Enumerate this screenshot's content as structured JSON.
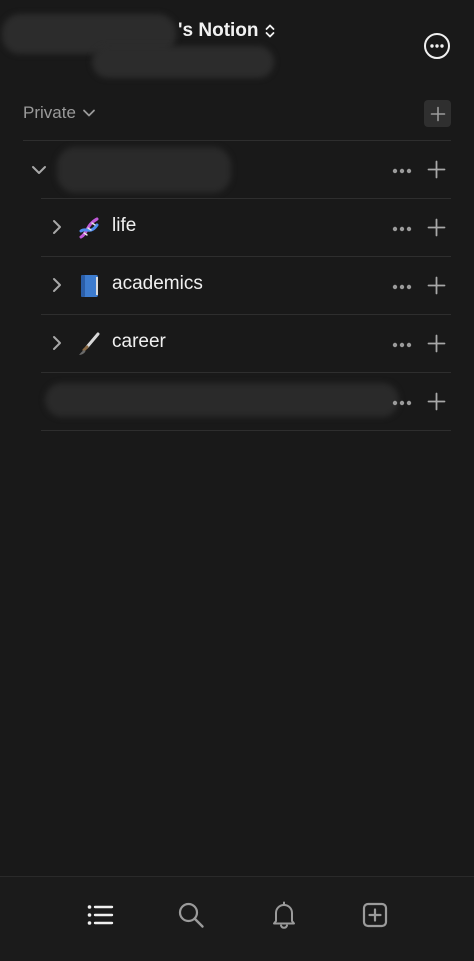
{
  "header": {
    "workspace_title": "'s Notion",
    "switcher_icon": "chevron-up-down-icon",
    "more_icon": "ellipsis-circle-icon"
  },
  "sidebar": {
    "section_label": "Private",
    "section_chevron_icon": "chevron-down-icon",
    "section_add_icon": "plus-icon",
    "root_page": {
      "label": "",
      "expanded": true
    },
    "child_pages": [
      {
        "label": "life",
        "icon": "dna-icon"
      },
      {
        "label": "academics",
        "icon": "blue-book-icon"
      },
      {
        "label": "career",
        "icon": "paintbrush-icon"
      },
      {
        "label": "",
        "icon": ""
      }
    ]
  },
  "tabbar": {
    "items": [
      {
        "name": "home",
        "icon": "list-icon",
        "active": true
      },
      {
        "name": "search",
        "icon": "search-icon",
        "active": false
      },
      {
        "name": "inbox",
        "icon": "bell-icon",
        "active": false
      },
      {
        "name": "new-page",
        "icon": "plus-square-icon",
        "active": false
      }
    ]
  },
  "colors": {
    "background": "#191919",
    "text": "#ebebeb",
    "muted": "#9b9b9b",
    "divider": "#2e2e2e"
  }
}
